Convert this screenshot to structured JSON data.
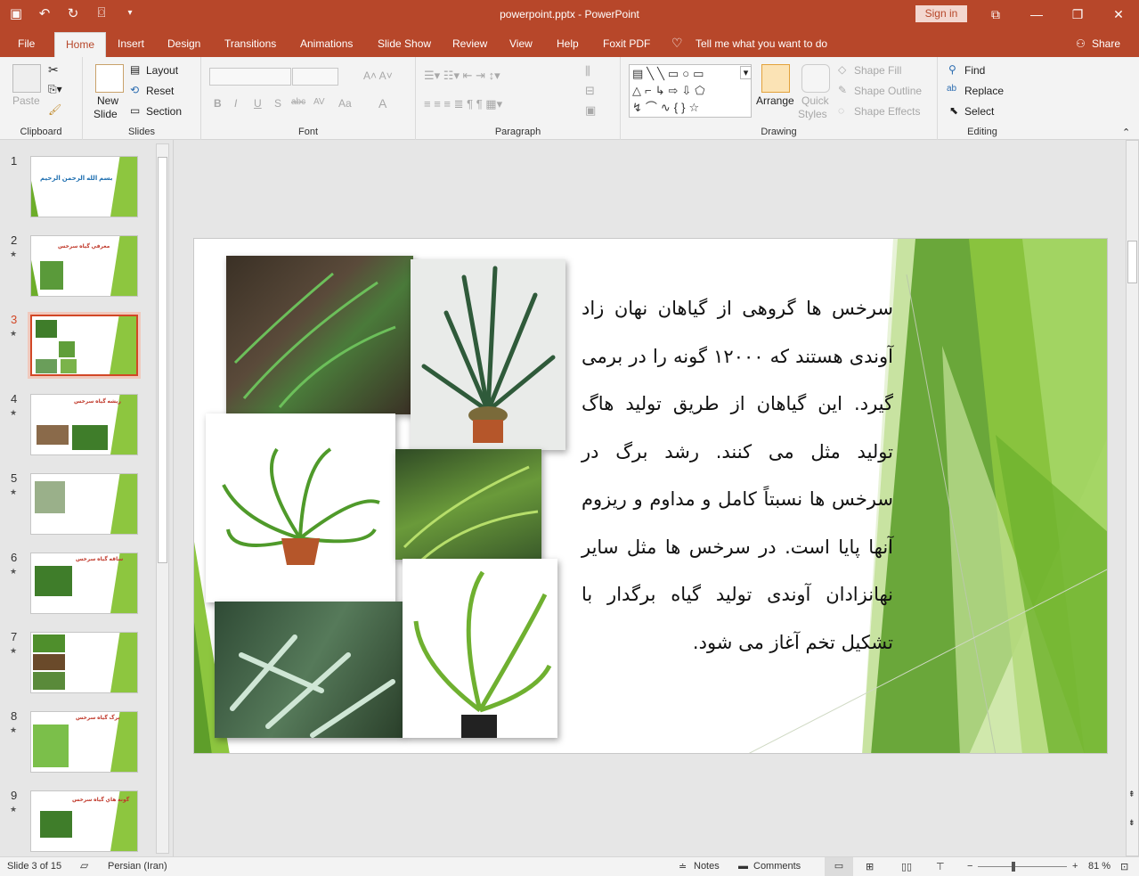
{
  "titlebar": {
    "doc_title": "powerpoint.pptx  -  PowerPoint",
    "sign_in": "Sign in",
    "qat": [
      "save-icon",
      "undo-icon",
      "redo-icon",
      "start-slideshow-icon",
      "customize-icon"
    ]
  },
  "tabs": [
    "File",
    "Home",
    "Insert",
    "Design",
    "Transitions",
    "Animations",
    "Slide Show",
    "Review",
    "View",
    "Help",
    "Foxit PDF"
  ],
  "active_tab": "Home",
  "tell_me": "Tell me what you want to do",
  "share": "Share",
  "ribbon": {
    "clipboard": {
      "label": "Clipboard",
      "paste": "Paste"
    },
    "slides": {
      "label": "Slides",
      "new_slide_1": "New",
      "new_slide_2": "Slide",
      "layout": "Layout",
      "reset": "Reset",
      "section": "Section"
    },
    "font": {
      "label": "Font",
      "buttons": [
        "B",
        "I",
        "U",
        "S",
        "abc",
        "AV",
        "Aa",
        "A"
      ]
    },
    "paragraph": {
      "label": "Paragraph"
    },
    "drawing": {
      "label": "Drawing",
      "arrange": "Arrange",
      "quick_1": "Quick",
      "quick_2": "Styles",
      "shape_fill": "Shape Fill",
      "shape_outline": "Shape Outline",
      "shape_effects": "Shape Effects"
    },
    "editing": {
      "label": "Editing",
      "find": "Find",
      "replace": "Replace",
      "select": "Select"
    }
  },
  "thumbnails": [
    {
      "num": "1",
      "star": "",
      "title": "بسم الله الرحمن الرحيم"
    },
    {
      "num": "2",
      "star": "★",
      "title": "معرفي گياه سرخس"
    },
    {
      "num": "3",
      "star": "★",
      "title": ""
    },
    {
      "num": "4",
      "star": "★",
      "title": "ريشه گياه سرخس"
    },
    {
      "num": "5",
      "star": "★",
      "title": ""
    },
    {
      "num": "6",
      "star": "★",
      "title": "ساقه گياه سرخس"
    },
    {
      "num": "7",
      "star": "★",
      "title": ""
    },
    {
      "num": "8",
      "star": "★",
      "title": "برگ گياه سرخس"
    },
    {
      "num": "9",
      "star": "★",
      "title": "گونه هاي گياه سرخس"
    }
  ],
  "slide": {
    "text": "سرخس ها گروهی از گیاهان نهان زاد آوندی هستند که ۱۲۰۰۰ گونه را در برمی گیرد. این گیاهان از طریق تولید هاگ تولید مثل می کنند. رشد برگ در سرخس ها نسبتاً کامل و مداوم و ریزوم آنها پایا است. در سرخس ها مثل سایر نهانزادان آوندی تولید گیاه برگدار با تشکیل تخم آغاز می شود."
  },
  "status": {
    "slide_info": "Slide 3 of 15",
    "language": "Persian (Iran)",
    "notes": "Notes",
    "comments": "Comments",
    "zoom_minus": "−",
    "zoom_plus": "+",
    "zoom": "81 %"
  },
  "colors": {
    "accent": "#b7472a",
    "green_light": "#8dc63f",
    "green_dark": "#4f8f2c"
  }
}
